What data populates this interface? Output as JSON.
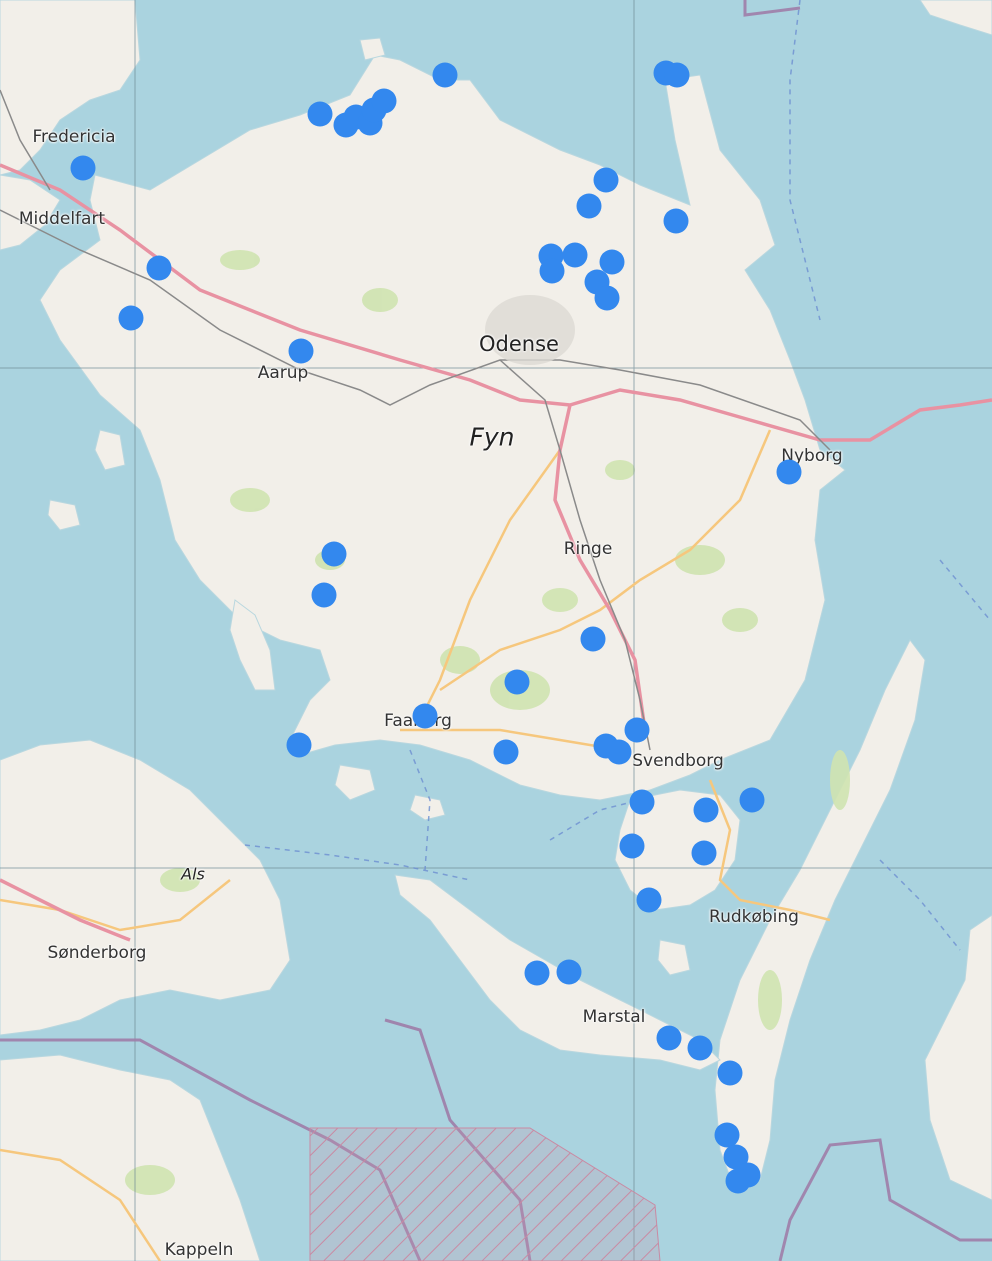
{
  "map": {
    "place_labels": [
      {
        "key": "fredericia",
        "text": "Fredericia"
      },
      {
        "key": "middelfart",
        "text": "Middelfart"
      },
      {
        "key": "aarup",
        "text": "Aarup"
      },
      {
        "key": "odense",
        "text": "Odense"
      },
      {
        "key": "fyn",
        "text": "Fyn"
      },
      {
        "key": "nyborg",
        "text": "Nyborg"
      },
      {
        "key": "ringe",
        "text": "Ringe"
      },
      {
        "key": "faaborg",
        "text": "Faaborg"
      },
      {
        "key": "svendborg",
        "text": "Svendborg"
      },
      {
        "key": "als",
        "text": "Als"
      },
      {
        "key": "sonderborg",
        "text": "Sønderborg"
      },
      {
        "key": "rudkobing",
        "text": "Rudkøbing"
      },
      {
        "key": "marstal",
        "text": "Marstal"
      },
      {
        "key": "kappeln",
        "text": "Kappeln"
      }
    ],
    "marker_color": "#3388ee",
    "land_color": "#f2efe9",
    "water_color": "#aad3df",
    "motorway_color": "#e892a2",
    "primary_road_color": "#f6c77d",
    "marker_count": 48
  }
}
